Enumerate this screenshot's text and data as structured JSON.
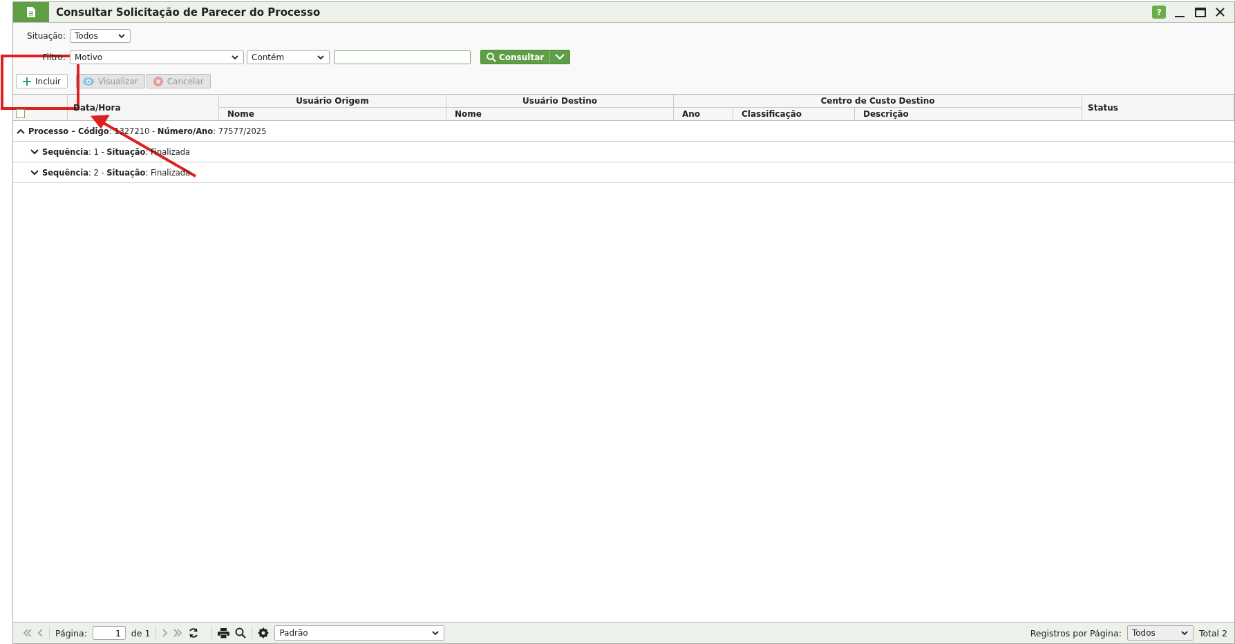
{
  "window": {
    "title": "Consultar Solicitação de Parecer do Processo",
    "help": "?"
  },
  "filters": {
    "situacao": {
      "label": "Situação:",
      "value": "Todos"
    },
    "filtro": {
      "label": "Filtro:",
      "field": "Motivo",
      "operator": "Contém"
    },
    "search_button": "Consultar"
  },
  "actions": [
    {
      "kind": "add",
      "label": "Incluir",
      "disabled": false
    },
    {
      "kind": "view",
      "label": "Visualizar",
      "disabled": true
    },
    {
      "kind": "cancel",
      "label": "Cancelar",
      "disabled": true
    }
  ],
  "table": {
    "select_all": {
      "checked": false
    },
    "date_column": "Data/Hora",
    "groups": [
      {
        "title": "Usuário Origem",
        "columns": [
          "Nome"
        ]
      },
      {
        "title": "Usuário Destino",
        "columns": [
          "Nome"
        ]
      },
      {
        "title": "Centro de Custo Destino",
        "columns": [
          "Ano",
          "Classificação",
          "Descrição"
        ]
      }
    ],
    "status_column": "Status",
    "tree": [
      {
        "text": "**Processo – Código**: 1327210 - **Número/Ano**: 77577/2025",
        "expanded": true,
        "children": [
          {
            "text": "**Sequência**: 1 - **Situação**: Finalizada",
            "expanded": false
          },
          {
            "text": "**Sequência**: 2 - **Situação**: Finalizada",
            "expanded": false
          }
        ]
      }
    ]
  },
  "pagination": {
    "page_label": "Página:",
    "page": "1",
    "of": "de 1",
    "layout": "Padrão",
    "per_page_label": "Registros por Página:",
    "per_page": "Todos",
    "total": "Total 2"
  },
  "annotation": {
    "kind": "highlight-arrow"
  }
}
